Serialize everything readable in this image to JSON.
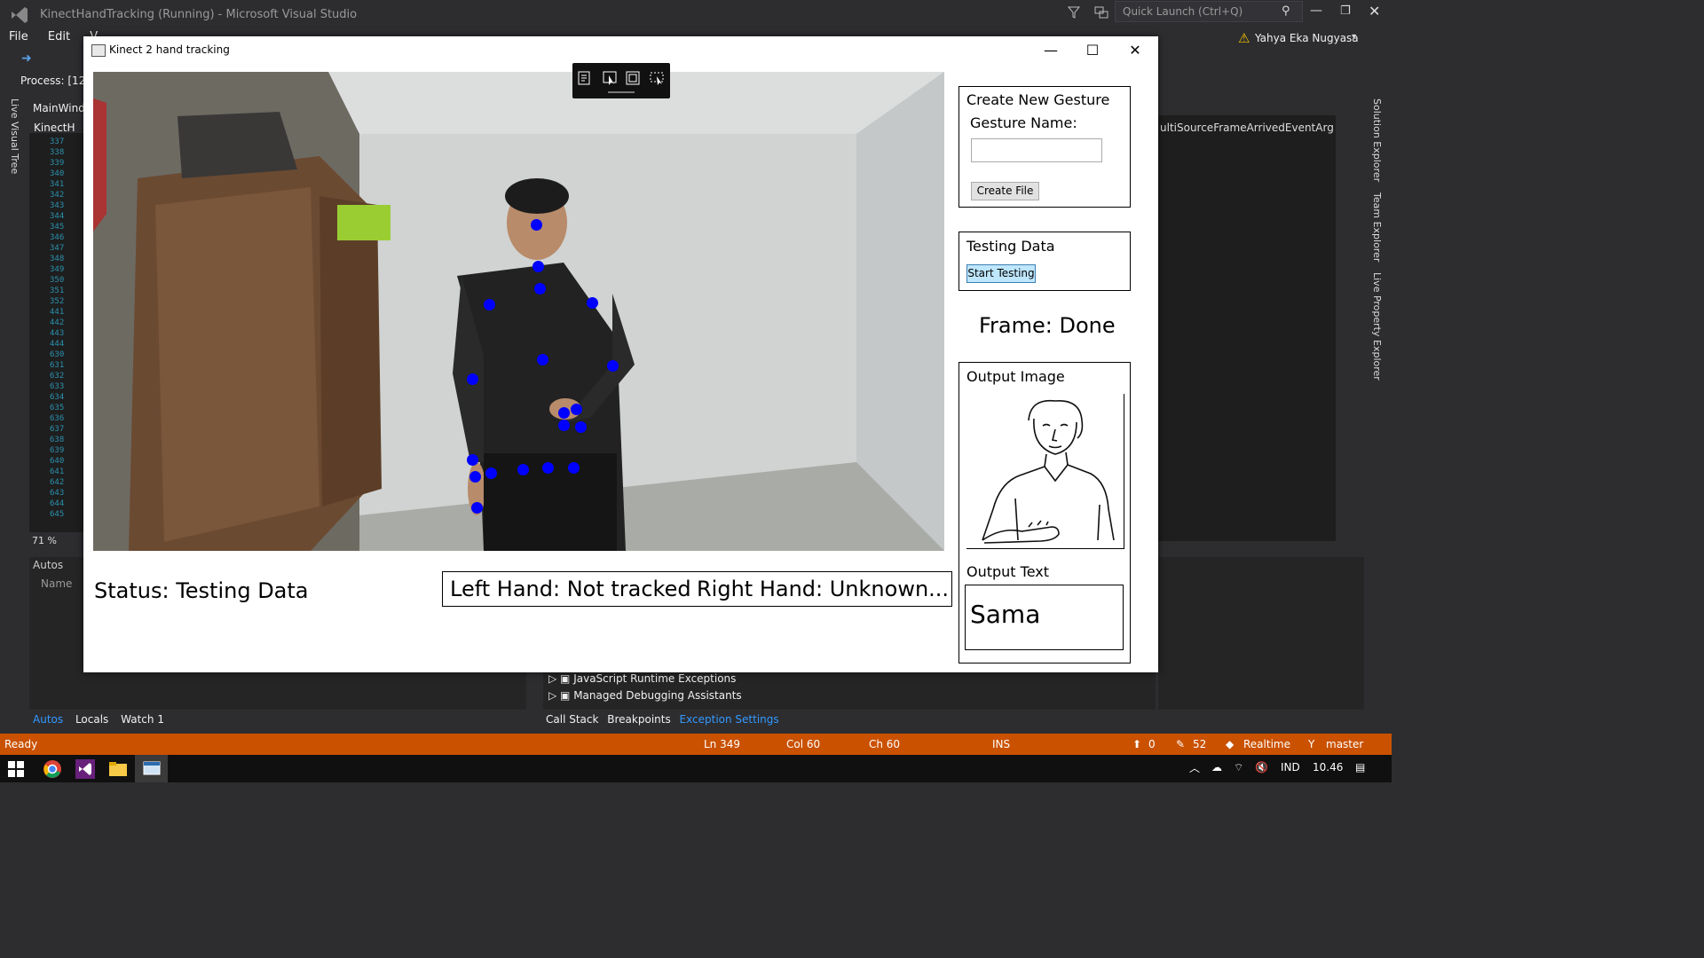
{
  "vs": {
    "title": "KinectHandTracking (Running) - Microsoft Visual Studio",
    "quick_launch_placeholder": "Quick Launch (Ctrl+Q)",
    "user": "Yahya Eka Nugyasa",
    "menu": [
      "File",
      "Edit",
      "V"
    ],
    "process_label": "Process: [12",
    "left_tab_1": "MainWind",
    "left_tab_2": "KinectH",
    "side_tab": "Live Visual Tree",
    "line_numbers": [
      "337",
      "338",
      "339",
      "340",
      "341",
      "342",
      "343",
      "344",
      "345",
      "346",
      "347",
      "348",
      "349",
      "350",
      "351",
      "352",
      "441",
      "442",
      "443",
      "444",
      "630",
      "631",
      "632",
      "633",
      "634",
      "635",
      "636",
      "637",
      "638",
      "639",
      "640",
      "641",
      "642",
      "643",
      "644",
      "645"
    ],
    "zoom": "71 %",
    "autos_title": "Autos",
    "autos_col": "Name",
    "bottom_tabs_left": [
      "Autos",
      "Locals",
      "Watch 1"
    ],
    "bottom_tabs_right": [
      "Call Stack",
      "Breakpoints",
      "Exception Settings"
    ],
    "exceptions": [
      "JavaScript Runtime Exceptions",
      "Managed Debugging Assistants"
    ],
    "right_editor_text": "ultiSourceFrameArrivedEventArg",
    "right_side_tabs": [
      "Solution Explorer",
      "Team Explorer",
      "Live Property Explorer"
    ],
    "statusbar": {
      "ready": "Ready",
      "ln": "Ln 349",
      "col": "Col 60",
      "ch": "Ch 60",
      "ins": "INS",
      "up": "0",
      "edits": "52",
      "realtime": "Realtime",
      "branch": "master"
    },
    "taskbar": {
      "lang": "IND",
      "time": "10.46"
    }
  },
  "app": {
    "title": "Kinect 2 hand tracking",
    "create_gesture": {
      "header": "Create New Gesture",
      "name_label": "Gesture Name:",
      "name_value": "",
      "button": "Create File"
    },
    "testing": {
      "header": "Testing Data",
      "button": "Start Testing"
    },
    "frame_status": "Frame: Done",
    "output_image_label": "Output Image",
    "output_text_label": "Output Text",
    "output_text": "Sama",
    "status": "Status: Testing Data",
    "left_hand": "Left Hand: Not tracked",
    "right_hand": "Right Hand: Unknown..."
  },
  "colors": {
    "vs_status": "#ca5100",
    "joint": "#0000ff",
    "vs_accent": "#3399ff"
  }
}
